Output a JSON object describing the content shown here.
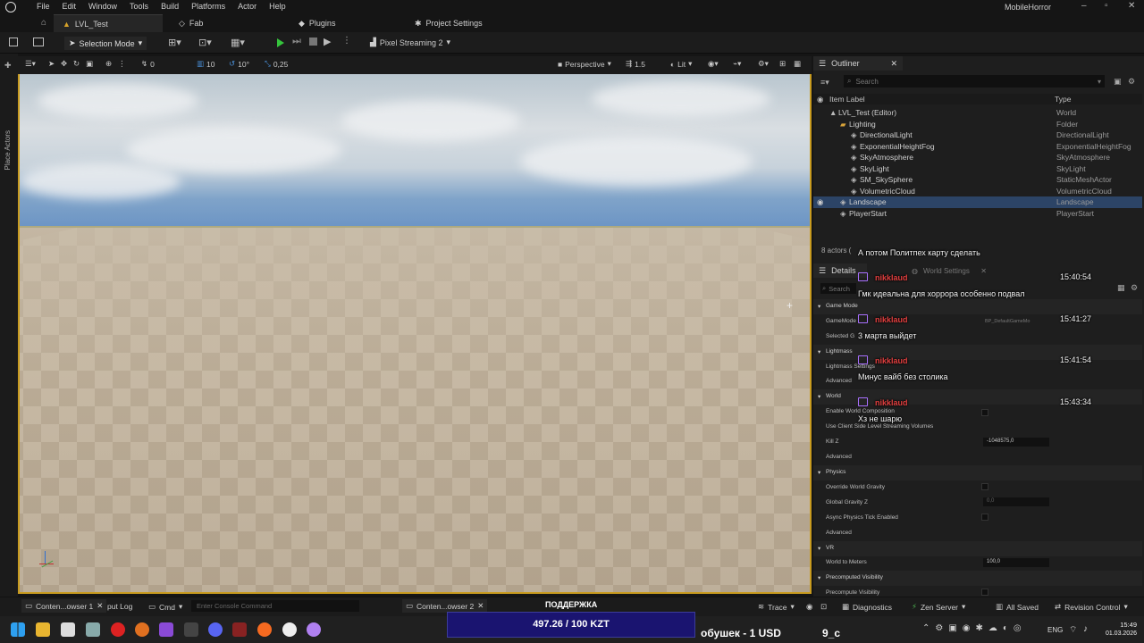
{
  "app": {
    "title": "MobileHorror"
  },
  "menu": [
    "File",
    "Edit",
    "Window",
    "Tools",
    "Build",
    "Platforms",
    "Actor",
    "Help"
  ],
  "tabs": {
    "level": "LVL_Test",
    "fab": "Fab",
    "plugins": "Plugins",
    "project_settings": "Project Settings"
  },
  "toolbar": {
    "mode": "Selection Mode",
    "streaming": "Pixel Streaming 2"
  },
  "viewport_toolbar": {
    "grid_snap": "10",
    "rot_snap": "10°",
    "scale_snap": "0,25",
    "snap_zero": "0",
    "view": "Perspective",
    "fov": "1.5",
    "lit": "Lit"
  },
  "left_strip": {
    "place_actors": "Place Actors"
  },
  "outliner": {
    "tab": "Outliner",
    "search_placeholder": "Search",
    "col_label": "Item Label",
    "col_type": "Type",
    "rows": [
      {
        "name": "LVL_Test (Editor)",
        "type": "World"
      },
      {
        "name": "Lighting",
        "type": "Folder"
      },
      {
        "name": "DirectionalLight",
        "type": "DirectionalLight"
      },
      {
        "name": "ExponentialHeightFog",
        "type": "ExponentialHeightFog"
      },
      {
        "name": "SkyAtmosphere",
        "type": "SkyAtmosphere"
      },
      {
        "name": "SkyLight",
        "type": "SkyLight"
      },
      {
        "name": "SM_SkySphere",
        "type": "StaticMeshActor"
      },
      {
        "name": "VolumetricCloud",
        "type": "VolumetricCloud"
      },
      {
        "name": "Landscape",
        "type": "Landscape"
      },
      {
        "name": "PlayerStart",
        "type": "PlayerStart"
      }
    ],
    "count": "8 actors ("
  },
  "details": {
    "tab": "Details",
    "world_settings_tab": "World Settings",
    "search_placeholder": "Search",
    "rows": [
      {
        "label": "Game Mode",
        "section": true
      },
      {
        "label": "GameMode",
        "section": false
      },
      {
        "label": "Selected G",
        "section": false
      },
      {
        "label": "Lightmass",
        "section": true
      },
      {
        "label": "Lightmass Settings",
        "section": false
      },
      {
        "label": "Advanced",
        "section": false
      },
      {
        "label": "World",
        "section": true
      },
      {
        "label": "Enable World Composition",
        "section": false
      },
      {
        "label": "Use Client Side Level Streaming Volumes",
        "section": false
      },
      {
        "label": "Kill Z",
        "section": false
      },
      {
        "label": "Advanced",
        "section": false
      },
      {
        "label": "Physics",
        "section": true
      },
      {
        "label": "Override World Gravity",
        "section": false
      },
      {
        "label": "Global Gravity Z",
        "section": false
      },
      {
        "label": "Async Physics Tick Enabled",
        "section": false
      },
      {
        "label": "Advanced",
        "section": false
      },
      {
        "label": "VR",
        "section": true
      },
      {
        "label": "World to Meters",
        "section": false
      },
      {
        "label": "Precomputed Visibility",
        "section": true
      },
      {
        "label": "Precompute Visibility",
        "section": false
      }
    ],
    "gamemode_value": "BP_DefaultGameMo",
    "killz_value": "-1048575,0",
    "gravity_value": "0,0",
    "world_to_meters_value": "100,0"
  },
  "chat": {
    "header": "А потом Политпех карту сделать",
    "messages": [
      {
        "user": "nikklaud",
        "time": "15:40:54",
        "text": "Гмк идеальна для хоррора особенно подвал"
      },
      {
        "user": "nikklaud",
        "time": "15:41:27",
        "text": "3 марта выйдет"
      },
      {
        "user": "nikklaud",
        "time": "15:41:54",
        "text": "Минус вайб без столика"
      },
      {
        "user": "nikklaud",
        "time": "15:43:34",
        "text": "Хз не шарю"
      }
    ]
  },
  "bottom_bar": {
    "content_browser_1": "Conten...owser 1",
    "output_log": "put Log",
    "cmd": "Cmd",
    "console_placeholder": "Enter Console Command",
    "content_browser_2": "Conten...owser 2",
    "trace": "Trace",
    "diagnostics": "Diagnostics",
    "zen_server": "Zen Server",
    "all_saved": "All Saved",
    "revision_control": "Revision Control"
  },
  "overlay": {
    "support": "ПОДДЕРЖКА",
    "donation": "497.26 / 100 KZT",
    "ticker_left": "обушек - 1 USD",
    "ticker_right": "9_с"
  },
  "taskbar": {
    "lang": "ENG",
    "time": "15:49",
    "date": "01.03.2026"
  },
  "colors": {
    "accent": "#c89b1f",
    "selection": "#2c4466",
    "chat_user": "#e34040",
    "twitch": "#a970ff",
    "donation_bg": "#1a1470"
  }
}
